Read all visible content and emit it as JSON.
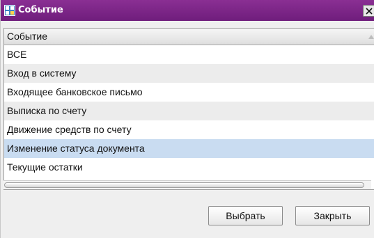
{
  "window": {
    "title": "Событие",
    "close_glyph": "✕"
  },
  "table": {
    "column_header": "Событие",
    "rows": [
      {
        "label": "ВСЕ"
      },
      {
        "label": "Вход в систему"
      },
      {
        "label": "Входящее банковское письмо"
      },
      {
        "label": "Выписка по счету"
      },
      {
        "label": "Движение средств по счету"
      },
      {
        "label": "Изменение статуса документа"
      },
      {
        "label": "Текущие остатки"
      }
    ],
    "selected_index": 5
  },
  "buttons": {
    "select_label": "Выбрать",
    "close_label": "Закрыть"
  },
  "colors": {
    "titlebar": "#7a2487",
    "selection": "#c9dcf1",
    "alt_row": "#ececec"
  },
  "icons": {
    "window_icon": "app-window-icon",
    "close_icon": "close-icon",
    "sort_icon": "sort-ascending-icon"
  }
}
